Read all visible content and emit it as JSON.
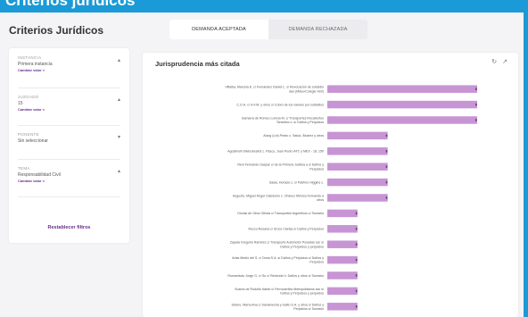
{
  "banner": {
    "title": "Criterios jurídicos"
  },
  "app": {
    "title": "Criterios Jurídicos"
  },
  "tabs": [
    {
      "label": "DEMANDA ACEPTADA",
      "active": true
    },
    {
      "label": "DEMANDA RECHAZADA",
      "active": false
    }
  ],
  "filters": [
    {
      "category": "INSTANCIA",
      "value": "Primera instancia",
      "link": "Cambiar valor >"
    },
    {
      "category": "JUZGADO",
      "value": "15",
      "link": "Cambiar valor >"
    },
    {
      "category": "PONENTE",
      "value": "Sin seleccionar",
      "link": ""
    },
    {
      "category": "TEMA",
      "value": "Responsabilidad Civil",
      "link": "Cambiar valor >"
    }
  ],
  "reset_label": "Restablecer filtros",
  "panel": {
    "title": "Jurisprudencia más citada",
    "icons": [
      "refresh-icon",
      "export-icon"
    ]
  },
  "colors": {
    "bar": "#c795d4",
    "accent": "#6a2c8a",
    "banner": "#1a9ad6"
  },
  "chart_data": {
    "type": "bar",
    "orientation": "horizontal",
    "categories": [
      [
        "Villalba, Marcela E. c/ Fernández Daniel L. s/ Revocación de subsidio",
        "dao (Mdeo/Colegio Vetr)"
      ],
      [
        "C.O.A. c/ H.F.M. y otros s/ Cobro de los valores por subsidios"
      ],
      [
        "Gamarra de Romeo Lorena M. c/ Transportes Rocabertoo",
        "Tarantino c. s/ Daños y Perjuicios"
      ],
      [
        "Alzog (Lot) Pedro c. Salud, Álvarez y otros"
      ],
      [
        "Agostinelli Silvia Beatriz c. Pasco, Juan Pedro ATC y MEX - 18, 150"
      ],
      [
        "Reni Fernando Gaspar c/ de la Primera Justicia a s/ Daños y",
        "Perjuicios"
      ],
      [
        "Salas, Horacio c. s/ Patrimo Higgins c."
      ],
      [
        "Augusto, Miguel Ángel Caledonio c. Chávez Mónica Fernando a",
        "otros"
      ],
      [
        "Dionisi de Olmo Olinda c/ Transportes Argentinos c/ Sumario"
      ],
      [
        "Rocco Rosana c/ Sroco Clarisa s/ Daños y Perjuicios"
      ],
      [
        "Zapata Gregorio Ramírez c/ Transporte Automotor Posadas ssc s/",
        "Daños y Perjuicios y perjuicios"
      ],
      [
        "Arias Medio del S. c/ Duna S.A. s/ Daños y Perjuicios s/ Daños y",
        "Perjuicios"
      ],
      [
        "Romanisolo Jorge G. c/ Su c/ Redondo h. Daños y otros s/ Sumario"
      ],
      [
        "Suarez de Rodolfo Nahiri c/ Ferrocarriles Metropolitanos ssc s/",
        "Daños y Perjuicios y perjuicios"
      ],
      [
        "Sbarro, María Ana c/ Sanderecha y Gatto S.A. y otros s/ Daños y",
        "Perjuicios s/ Sumario"
      ]
    ],
    "values": [
      4,
      3,
      3,
      1,
      1,
      1,
      1,
      1,
      0.5,
      0.5,
      0.5,
      0.5,
      0.5,
      0.5,
      0.5
    ],
    "xlim": [
      0,
      3
    ],
    "x_ticks": [
      "0",
      "1",
      "2",
      "3"
    ],
    "grid": false
  }
}
